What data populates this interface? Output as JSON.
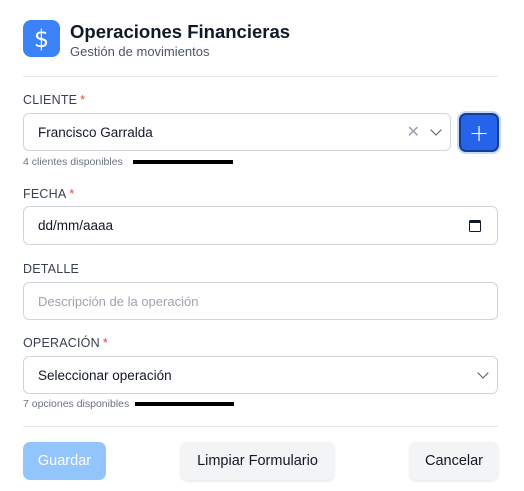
{
  "header": {
    "icon": "dollar-icon",
    "title": "Operaciones Financieras",
    "subtitle": "Gestión de movimientos",
    "accent_color": "#3b82f6"
  },
  "cliente": {
    "label": "CLIENTE",
    "required_mark": "*",
    "value": "Francisco Garralda",
    "hint": "4 clientes disponibles",
    "add_button": "+"
  },
  "fecha": {
    "label": "FECHA",
    "required_mark": "*",
    "value": "dd/mm/aaaa"
  },
  "detalle": {
    "label": "DETALLE",
    "placeholder": "Descripción de la operación"
  },
  "operacion": {
    "label": "OPERACIÓN",
    "required_mark": "*",
    "value": "Seleccionar operación",
    "hint": "7 opciones disponibles"
  },
  "actions": {
    "save": "Guardar",
    "clear": "Limpiar Formulario",
    "cancel": "Cancelar"
  }
}
